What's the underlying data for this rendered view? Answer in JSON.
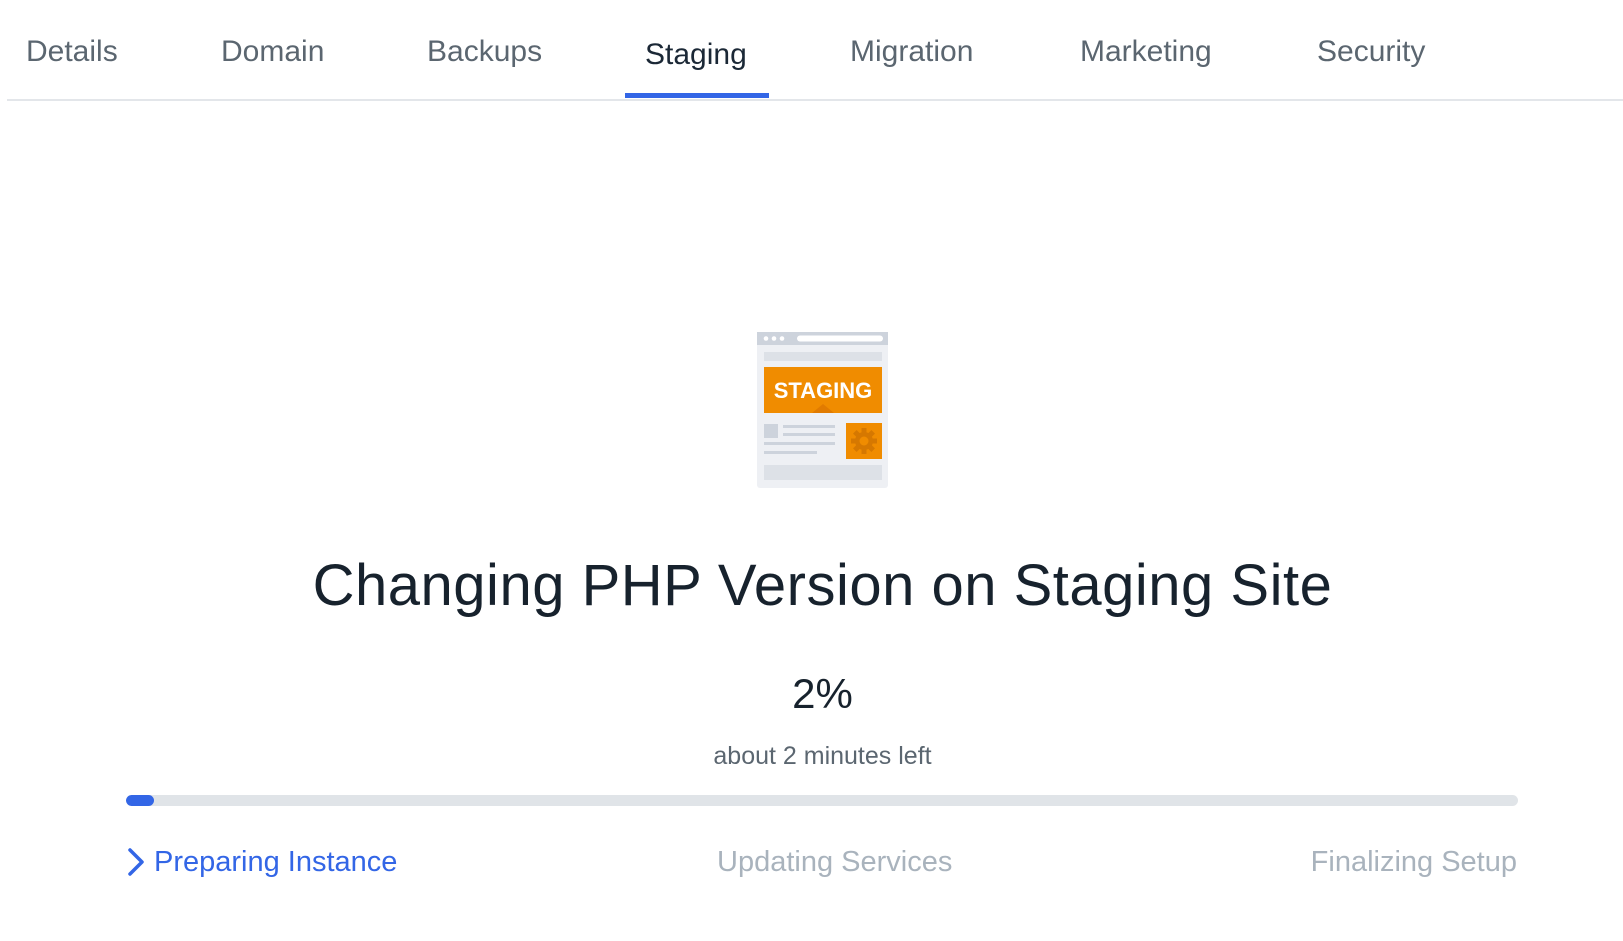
{
  "tabs": [
    {
      "label": "Details",
      "active": false
    },
    {
      "label": "Domain",
      "active": false
    },
    {
      "label": "Backups",
      "active": false
    },
    {
      "label": "Staging",
      "active": true
    },
    {
      "label": "Migration",
      "active": false
    },
    {
      "label": "Marketing",
      "active": false
    },
    {
      "label": "Security",
      "active": false
    }
  ],
  "illustration": {
    "icon": "staging-site-icon",
    "badge_label": "STAGING"
  },
  "status": {
    "title": "Changing PHP Version on Staging Site",
    "percent_label": "2%",
    "progress": 0.02,
    "eta": "about 2 minutes left"
  },
  "steps": [
    {
      "label": "Preparing Instance",
      "state": "current",
      "icon": "chevron-right-icon"
    },
    {
      "label": "Updating Services",
      "state": "pending"
    },
    {
      "label": "Finalizing Setup",
      "state": "pending"
    }
  ],
  "colors": {
    "accent": "#3366e6",
    "pending_text": "#a9b3bd",
    "illustration_orange": "#f08c00"
  }
}
